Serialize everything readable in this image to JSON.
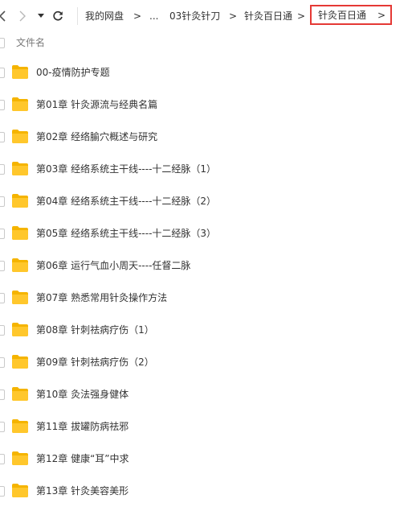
{
  "toolbar": {
    "back_icon": "chevron-left-icon",
    "forward_icon": "chevron-right-icon",
    "dropdown_icon": "caret-down-icon",
    "refresh_icon": "refresh-icon"
  },
  "breadcrumb": {
    "items": [
      "我的网盘",
      "...",
      "03针灸针刀",
      "针灸百日通"
    ],
    "separator": ">",
    "current": "针灸百日通",
    "current_arrow": ">",
    "highlight_color": "#e53935"
  },
  "column_header": {
    "name": "文件名"
  },
  "folder_color": "#ffc72c",
  "files": [
    {
      "name": "00-疫情防护专题",
      "icon": "folder-icon"
    },
    {
      "name": "第01章 针灸源流与经典名篇",
      "icon": "folder-icon"
    },
    {
      "name": "第02章 经络腧穴概述与研究",
      "icon": "folder-icon"
    },
    {
      "name": "第03章 经络系统主干线----十二经脉（1）",
      "icon": "folder-icon"
    },
    {
      "name": "第04章 经络系统主干线----十二经脉（2）",
      "icon": "folder-icon"
    },
    {
      "name": "第05章 经络系统主干线----十二经脉（3）",
      "icon": "folder-icon"
    },
    {
      "name": "第06章 运行气血小周天----任督二脉",
      "icon": "folder-icon"
    },
    {
      "name": "第07章 熟悉常用针灸操作方法",
      "icon": "folder-icon"
    },
    {
      "name": "第08章 针刺祛病疗伤（1）",
      "icon": "folder-icon"
    },
    {
      "name": "第09章 针刺祛病疗伤（2）",
      "icon": "folder-icon"
    },
    {
      "name": "第10章 灸法强身健体",
      "icon": "folder-icon"
    },
    {
      "name": "第11章 拔罐防病祛邪",
      "icon": "folder-icon"
    },
    {
      "name": "第12章 健康“耳”中求",
      "icon": "folder-icon"
    },
    {
      "name": "第13章 针灸美容美形",
      "icon": "folder-icon"
    }
  ]
}
